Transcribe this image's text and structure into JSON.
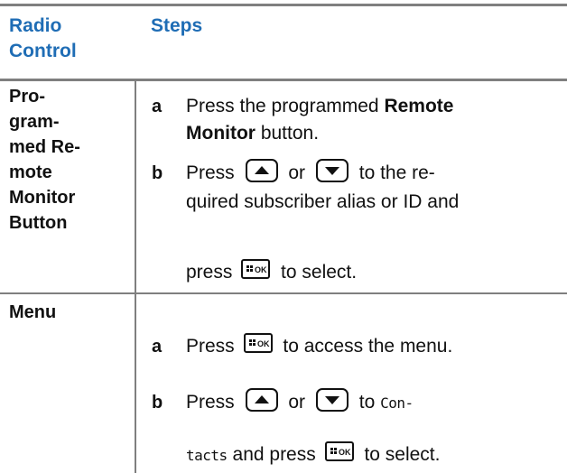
{
  "table": {
    "headers": {
      "radio_control": [
        "Radio",
        "Control"
      ],
      "steps": "Steps"
    },
    "rows": [
      {
        "control": [
          "Pro-",
          "gram-",
          "med Re-",
          "mote",
          "Monitor",
          "Button"
        ],
        "steps": [
          {
            "letter": "a",
            "lines": [
              "Press the programmed ",
              "Remote",
              "Monitor",
              " button."
            ]
          },
          {
            "letter": "b",
            "press": "Press",
            "or": "or",
            "tail1": "to the re-",
            "line2": "quired subscriber alias or ID and",
            "line3_pre": "press",
            "line3_post": "to select."
          }
        ]
      },
      {
        "control": [
          "Menu"
        ],
        "steps": [
          {
            "letter": "a",
            "press": "Press",
            "tail": "to access the menu."
          },
          {
            "letter": "b",
            "press": "Press",
            "or": "or",
            "tail_pre": "to",
            "code1": "Con-",
            "code2": "tacts",
            "tail2": "and press",
            "tail3": "to select."
          }
        ]
      }
    ]
  },
  "keys": {
    "up": "up-arrow-key-icon",
    "down": "down-arrow-key-icon",
    "ok": {
      "icon": "menu-ok-key-icon",
      "label": "OK"
    }
  },
  "colors": {
    "header": "#1f6db5",
    "rule": "#7f7f7f"
  }
}
